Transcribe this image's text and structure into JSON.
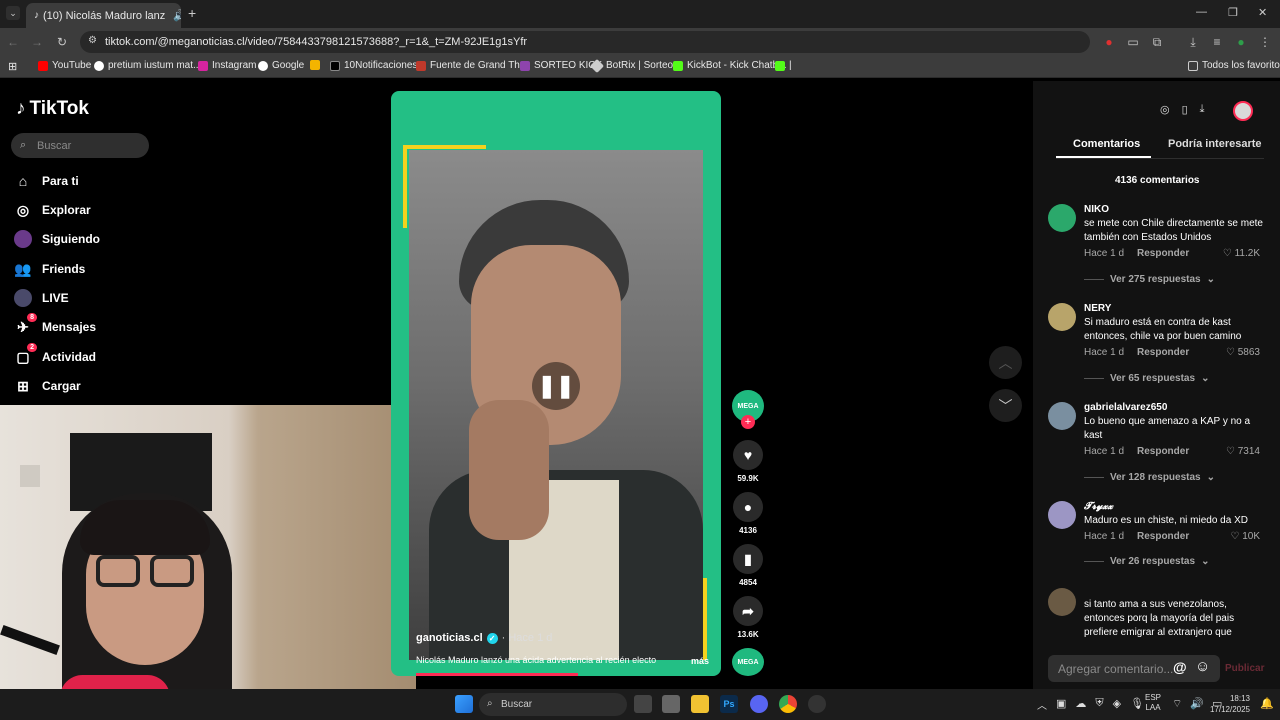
{
  "browser": {
    "tab": {
      "title": "(10) Nicolás Maduro lanz",
      "close": "✕"
    },
    "new_tab": "+",
    "url": "tiktok.com/@meganoticias.cl/video/7584433798121573688?_r=1&_t=ZM-92JE1g1sYfr",
    "bookmarks": [
      "YouTube",
      "pretium iustum mat...",
      "Instagram",
      "Google",
      "",
      "10Notificaciones",
      "Fuente de Grand Th...",
      "SORTEO KICK",
      "BotRix | Sorteos",
      "KickBot - Kick Chatb...",
      "Todos los favoritos"
    ]
  },
  "tiktok": {
    "logo": "TikTok",
    "search_placeholder": "Buscar",
    "nav": [
      {
        "label": "Para ti",
        "icon": "home-icon"
      },
      {
        "label": "Explorar",
        "icon": "compass-icon"
      },
      {
        "label": "Siguiendo",
        "icon": "following-avatar-icon"
      },
      {
        "label": "Friends",
        "icon": "friends-icon"
      },
      {
        "label": "LIVE",
        "icon": "live-icon"
      },
      {
        "label": "Mensajes",
        "icon": "messages-icon",
        "badge": "8"
      },
      {
        "label": "Actividad",
        "icon": "activity-icon",
        "badge": "2"
      },
      {
        "label": "Cargar",
        "icon": "upload-icon"
      }
    ],
    "video": {
      "author": "ganoticias.cl",
      "time": "· Hace 1 d",
      "caption": "Nicolás Maduro lanzó una ácida advertencia al recién electo",
      "more": "más",
      "progress": 0.4
    },
    "actions": [
      {
        "name": "like",
        "count": "59.9K",
        "icon": "♥"
      },
      {
        "name": "comment",
        "count": "4136",
        "icon": "●"
      },
      {
        "name": "bookmark",
        "count": "4854",
        "icon": "▮"
      },
      {
        "name": "share",
        "count": "13.6K",
        "icon": "➦"
      }
    ],
    "tabs": {
      "comments": "Comentarios",
      "interest": "Podría interesarte"
    },
    "comment_count": "4136 comentarios",
    "comments": [
      {
        "name": "NIKO",
        "text": "se mete con Chile directamente se mete también con Estados Unidos",
        "time": "Hace 1 d",
        "reply": "Responder",
        "likes": "11.2K",
        "replies": "Ver 275 respuestas",
        "color": "#2ba86b"
      },
      {
        "name": "NERY",
        "text": "Si maduro está en contra de kast entonces, chile va por buen camino",
        "time": "Hace 1 d",
        "reply": "Responder",
        "likes": "5863",
        "replies": "Ver 65 respuestas",
        "color": "#b8a46a"
      },
      {
        "name": "gabrielalvarez650",
        "text": "Lo bueno que amenazo a KAP y no a kast",
        "time": "Hace 1 d",
        "reply": "Responder",
        "likes": "7314",
        "replies": "Ver 128 respuestas",
        "color": "#7a8fa0"
      },
      {
        "name": "𝓣𝓻𝔂𝔁𝔁",
        "text": "Maduro es un chiste, ni miedo da XD",
        "time": "Hace 1 d",
        "reply": "Responder",
        "likes": "10K",
        "replies": "Ver 26 respuestas",
        "color": "#9c96c4"
      },
      {
        "name": "",
        "text": "si tanto ama a sus venezolanos, entonces porq la mayoría del pais prefiere emigrar al extranjero que",
        "time": "",
        "reply": "",
        "likes": "",
        "replies": "",
        "color": "#6a5a44"
      }
    ],
    "add_comment_placeholder": "Agregar comentario...",
    "publish": "Publicar"
  },
  "taskbar": {
    "search": "Buscar",
    "lang": "ESP",
    "lang2": "LAA",
    "time": "18:13",
    "date": "17/12/2025"
  }
}
